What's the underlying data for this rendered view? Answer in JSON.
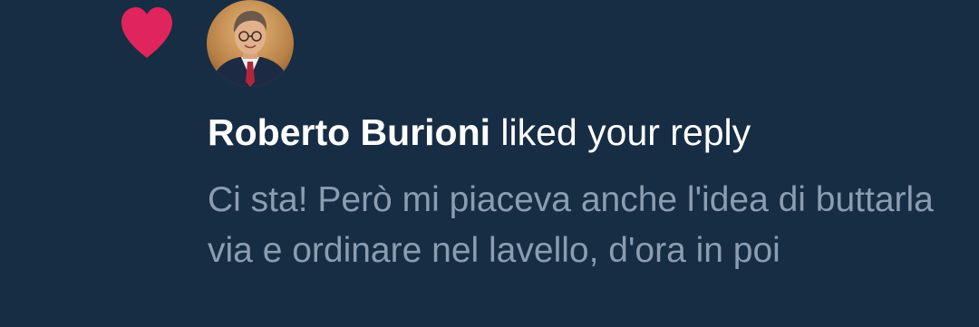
{
  "notification": {
    "type": "like",
    "icon": "heart-icon",
    "icon_color": "#e0245e",
    "avatar": "user-avatar",
    "user_name": "Roberto Burioni",
    "action_text": " liked your reply",
    "reply_text": "Ci sta! Però mi piaceva anche l'idea di buttarla via e ordinare nel lavello, d'ora in poi"
  },
  "colors": {
    "background": "#172d44",
    "primary_text": "#ffffff",
    "secondary_text": "#8b9db0"
  }
}
